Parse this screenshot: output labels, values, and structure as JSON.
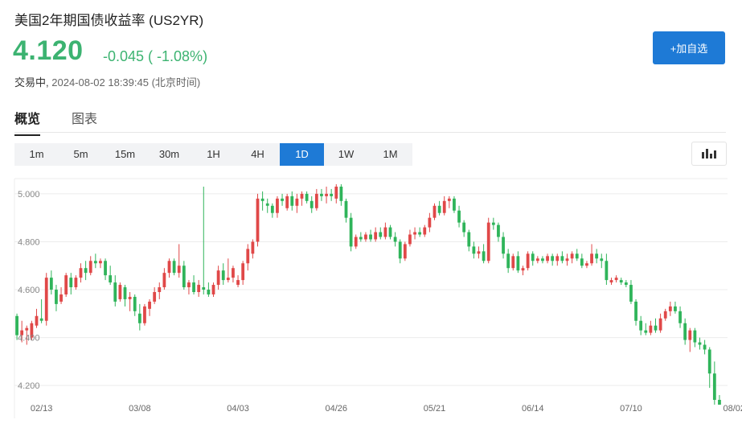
{
  "header": {
    "title": "美国2年期国债收益率  (US2YR)",
    "price": "4.120",
    "change": "-0.045 ( -1.08%)",
    "status": "交易中,",
    "timestamp": "2024-08-02 18:39:45 (北京时间)",
    "add_button": "+加自选"
  },
  "tabs": [
    {
      "label": "概览",
      "active": true
    },
    {
      "label": "图表",
      "active": false
    }
  ],
  "timeframes": [
    {
      "label": "1m",
      "active": false
    },
    {
      "label": "5m",
      "active": false
    },
    {
      "label": "15m",
      "active": false
    },
    {
      "label": "30m",
      "active": false
    },
    {
      "label": "1H",
      "active": false
    },
    {
      "label": "4H",
      "active": false
    },
    {
      "label": "1D",
      "active": true
    },
    {
      "label": "1W",
      "active": false
    },
    {
      "label": "1M",
      "active": false
    }
  ],
  "colors": {
    "up": "#e04848",
    "down": "#2fb45a",
    "accent": "#1e7ad6",
    "price": "#3cb371"
  },
  "chart_data": {
    "type": "candlestick",
    "title": "",
    "xlabel": "",
    "ylabel": "",
    "ylim": [
      4.14,
      5.05
    ],
    "yticks": [
      "4.200",
      "4.400",
      "4.600",
      "4.800",
      "5.000"
    ],
    "yticks_values": [
      4.2,
      4.4,
      4.6,
      4.8,
      5.0
    ],
    "xticks": [
      {
        "label": "02/13",
        "index": 5
      },
      {
        "label": "03/08",
        "index": 25
      },
      {
        "label": "04/03",
        "index": 45
      },
      {
        "label": "04/26",
        "index": 65
      },
      {
        "label": "05/21",
        "index": 85
      },
      {
        "label": "06/14",
        "index": 105
      },
      {
        "label": "07/10",
        "index": 125
      },
      {
        "label": "08/02",
        "index": 146
      }
    ],
    "grid": true,
    "candles": [
      [
        4.49,
        4.5,
        4.39,
        4.41
      ],
      [
        4.41,
        4.47,
        4.38,
        4.43
      ],
      [
        4.43,
        4.45,
        4.37,
        4.44
      ],
      [
        4.4,
        4.47,
        4.39,
        4.46
      ],
      [
        4.45,
        4.52,
        4.44,
        4.49
      ],
      [
        4.48,
        4.56,
        4.46,
        4.47
      ],
      [
        4.47,
        4.67,
        4.45,
        4.65
      ],
      [
        4.65,
        4.68,
        4.58,
        4.6
      ],
      [
        4.6,
        4.62,
        4.51,
        4.54
      ],
      [
        4.55,
        4.61,
        4.54,
        4.58
      ],
      [
        4.58,
        4.67,
        4.57,
        4.66
      ],
      [
        4.65,
        4.67,
        4.58,
        4.61
      ],
      [
        4.61,
        4.66,
        4.6,
        4.65
      ],
      [
        4.65,
        4.71,
        4.63,
        4.69
      ],
      [
        4.69,
        4.72,
        4.64,
        4.67
      ],
      [
        4.67,
        4.74,
        4.66,
        4.72
      ],
      [
        4.72,
        4.75,
        4.69,
        4.71
      ],
      [
        4.71,
        4.73,
        4.69,
        4.72
      ],
      [
        4.72,
        4.73,
        4.64,
        4.66
      ],
      [
        4.66,
        4.7,
        4.62,
        4.63
      ],
      [
        4.63,
        4.66,
        4.53,
        4.55
      ],
      [
        4.56,
        4.63,
        4.55,
        4.62
      ],
      [
        4.61,
        4.62,
        4.53,
        4.56
      ],
      [
        4.56,
        4.59,
        4.51,
        4.57
      ],
      [
        4.57,
        4.58,
        4.49,
        4.51
      ],
      [
        4.5,
        4.54,
        4.43,
        4.46
      ],
      [
        4.46,
        4.54,
        4.45,
        4.53
      ],
      [
        4.52,
        4.56,
        4.49,
        4.55
      ],
      [
        4.55,
        4.61,
        4.54,
        4.59
      ],
      [
        4.59,
        4.63,
        4.56,
        4.61
      ],
      [
        4.61,
        4.69,
        4.6,
        4.67
      ],
      [
        4.67,
        4.73,
        4.65,
        4.72
      ],
      [
        4.72,
        4.73,
        4.66,
        4.67
      ],
      [
        4.67,
        4.79,
        4.65,
        4.7
      ],
      [
        4.7,
        4.72,
        4.6,
        4.61
      ],
      [
        4.61,
        4.64,
        4.58,
        4.63
      ],
      [
        4.63,
        4.66,
        4.58,
        4.59
      ],
      [
        4.59,
        4.64,
        4.57,
        4.62
      ],
      [
        4.61,
        5.03,
        4.58,
        4.6
      ],
      [
        4.6,
        4.63,
        4.57,
        4.58
      ],
      [
        4.58,
        4.63,
        4.57,
        4.62
      ],
      [
        4.62,
        4.7,
        4.6,
        4.68
      ],
      [
        4.68,
        4.71,
        4.62,
        4.64
      ],
      [
        4.64,
        4.73,
        4.63,
        4.65
      ],
      [
        4.65,
        4.7,
        4.63,
        4.69
      ],
      [
        4.62,
        4.66,
        4.61,
        4.64
      ],
      [
        4.64,
        4.72,
        4.62,
        4.71
      ],
      [
        4.71,
        4.79,
        4.68,
        4.77
      ],
      [
        4.75,
        4.81,
        4.73,
        4.8
      ],
      [
        4.8,
        5.0,
        4.78,
        4.98
      ],
      [
        4.98,
        5.01,
        4.93,
        4.97
      ],
      [
        4.96,
        4.98,
        4.92,
        4.95
      ],
      [
        4.95,
        4.96,
        4.9,
        4.92
      ],
      [
        4.92,
        4.99,
        4.9,
        4.98
      ],
      [
        4.98,
        5.0,
        4.95,
        4.97
      ],
      [
        4.94,
        5.0,
        4.93,
        4.99
      ],
      [
        4.99,
        5.01,
        4.93,
        4.95
      ],
      [
        4.95,
        5.0,
        4.92,
        4.98
      ],
      [
        4.98,
        5.01,
        4.95,
        5.0
      ],
      [
        5.0,
        5.01,
        4.96,
        4.97
      ],
      [
        4.97,
        4.99,
        4.92,
        4.94
      ],
      [
        4.94,
        5.02,
        4.93,
        5.0
      ],
      [
        5.0,
        5.02,
        4.97,
        4.99
      ],
      [
        4.99,
        5.03,
        4.96,
        5.0
      ],
      [
        5.0,
        5.02,
        4.97,
        4.99
      ],
      [
        4.98,
        5.04,
        4.96,
        5.03
      ],
      [
        5.03,
        5.04,
        4.95,
        4.97
      ],
      [
        4.97,
        4.98,
        4.88,
        4.9
      ],
      [
        4.9,
        4.92,
        4.76,
        4.78
      ],
      [
        4.78,
        4.83,
        4.77,
        4.82
      ],
      [
        4.82,
        4.84,
        4.8,
        4.81
      ],
      [
        4.81,
        4.84,
        4.8,
        4.83
      ],
      [
        4.83,
        4.85,
        4.8,
        4.81
      ],
      [
        4.81,
        4.86,
        4.8,
        4.84
      ],
      [
        4.84,
        4.86,
        4.81,
        4.82
      ],
      [
        4.82,
        4.88,
        4.81,
        4.86
      ],
      [
        4.86,
        4.87,
        4.81,
        4.82
      ],
      [
        4.82,
        4.84,
        4.78,
        4.8
      ],
      [
        4.8,
        4.81,
        4.71,
        4.73
      ],
      [
        4.73,
        4.8,
        4.72,
        4.79
      ],
      [
        4.79,
        4.85,
        4.78,
        4.83
      ],
      [
        4.83,
        4.86,
        4.81,
        4.84
      ],
      [
        4.84,
        4.86,
        4.82,
        4.83
      ],
      [
        4.83,
        4.87,
        4.82,
        4.86
      ],
      [
        4.86,
        4.92,
        4.84,
        4.9
      ],
      [
        4.9,
        4.96,
        4.89,
        4.95
      ],
      [
        4.95,
        4.97,
        4.91,
        4.92
      ],
      [
        4.92,
        4.99,
        4.91,
        4.97
      ],
      [
        4.97,
        4.99,
        4.94,
        4.98
      ],
      [
        4.98,
        4.99,
        4.92,
        4.93
      ],
      [
        4.93,
        4.95,
        4.86,
        4.88
      ],
      [
        4.88,
        4.89,
        4.82,
        4.84
      ],
      [
        4.84,
        4.85,
        4.76,
        4.78
      ],
      [
        4.78,
        4.8,
        4.73,
        4.75
      ],
      [
        4.75,
        4.78,
        4.73,
        4.76
      ],
      [
        4.76,
        4.79,
        4.71,
        4.72
      ],
      [
        4.72,
        4.9,
        4.71,
        4.88
      ],
      [
        4.88,
        4.9,
        4.85,
        4.87
      ],
      [
        4.87,
        4.88,
        4.8,
        4.82
      ],
      [
        4.82,
        4.84,
        4.73,
        4.75
      ],
      [
        4.75,
        4.77,
        4.67,
        4.69
      ],
      [
        4.69,
        4.75,
        4.68,
        4.74
      ],
      [
        4.74,
        4.76,
        4.67,
        4.68
      ],
      [
        4.68,
        4.7,
        4.66,
        4.69
      ],
      [
        4.69,
        4.76,
        4.68,
        4.75
      ],
      [
        4.75,
        4.76,
        4.7,
        4.72
      ],
      [
        4.72,
        4.74,
        4.71,
        4.73
      ],
      [
        4.73,
        4.74,
        4.71,
        4.72
      ],
      [
        4.72,
        4.75,
        4.71,
        4.74
      ],
      [
        4.74,
        4.75,
        4.7,
        4.72
      ],
      [
        4.72,
        4.75,
        4.7,
        4.74
      ],
      [
        4.74,
        4.76,
        4.71,
        4.72
      ],
      [
        4.72,
        4.75,
        4.7,
        4.73
      ],
      [
        4.73,
        4.76,
        4.71,
        4.75
      ],
      [
        4.75,
        4.77,
        4.72,
        4.73
      ],
      [
        4.73,
        4.75,
        4.69,
        4.7
      ],
      [
        4.7,
        4.72,
        4.69,
        4.71
      ],
      [
        4.71,
        4.79,
        4.7,
        4.75
      ],
      [
        4.75,
        4.77,
        4.71,
        4.73
      ],
      [
        4.73,
        4.75,
        4.69,
        4.72
      ],
      [
        4.72,
        4.75,
        4.62,
        4.64
      ],
      [
        4.63,
        4.65,
        4.62,
        4.64
      ],
      [
        4.64,
        4.66,
        4.63,
        4.65
      ],
      [
        4.64,
        4.65,
        4.62,
        4.63
      ],
      [
        4.63,
        4.64,
        4.61,
        4.62
      ],
      [
        4.62,
        4.64,
        4.54,
        4.55
      ],
      [
        4.55,
        4.56,
        4.45,
        4.47
      ],
      [
        4.47,
        4.49,
        4.41,
        4.43
      ],
      [
        4.43,
        4.46,
        4.41,
        4.42
      ],
      [
        4.42,
        4.47,
        4.41,
        4.45
      ],
      [
        4.45,
        4.48,
        4.42,
        4.43
      ],
      [
        4.43,
        4.5,
        4.42,
        4.48
      ],
      [
        4.48,
        4.52,
        4.47,
        4.51
      ],
      [
        4.51,
        4.55,
        4.49,
        4.53
      ],
      [
        4.53,
        4.55,
        4.5,
        4.51
      ],
      [
        4.51,
        4.53,
        4.44,
        4.46
      ],
      [
        4.46,
        4.48,
        4.37,
        4.39
      ],
      [
        4.39,
        4.44,
        4.34,
        4.43
      ],
      [
        4.43,
        4.44,
        4.36,
        4.38
      ],
      [
        4.38,
        4.4,
        4.35,
        4.37
      ],
      [
        4.37,
        4.39,
        4.33,
        4.35
      ],
      [
        4.35,
        4.36,
        4.19,
        4.25
      ],
      [
        4.25,
        4.3,
        4.12,
        4.14
      ],
      [
        4.14,
        4.16,
        4.12,
        4.12
      ]
    ]
  }
}
